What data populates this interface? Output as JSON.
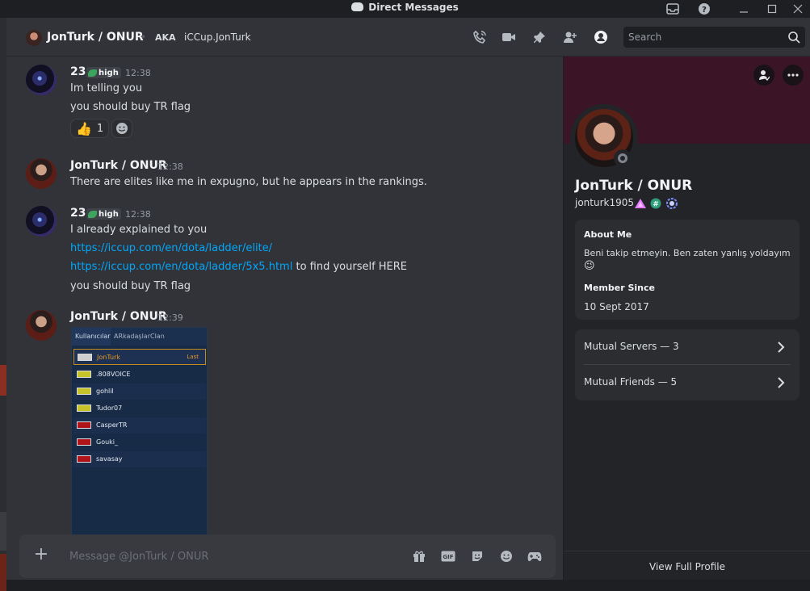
{
  "window": {
    "title": "Direct Messages"
  },
  "header": {
    "dm_name": "JonTurk / ONUR",
    "aka_label": "AKA",
    "aka_value": "iCCup.JonTurk",
    "search_placeholder": "Search"
  },
  "messages": [
    {
      "author": "23",
      "badge": "high",
      "time": "12:38",
      "lines": [
        "Im telling you",
        "you should buy TR flag"
      ],
      "reaction": {
        "emoji": "👍",
        "count": "1"
      }
    },
    {
      "author": "JonTurk / ONUR",
      "time": "12:38",
      "lines": [
        "There are elites like me in expugno, but he appears in the rankings."
      ]
    },
    {
      "author": "23",
      "badge": "high",
      "time": "12:38",
      "lines": [
        "I already explained to you",
        "https://iccup.com/en/dota/ladder/elite/",
        "https://iccup.com/en/dota/ladder/5x5.html",
        "to find yourself HERE",
        "you should buy TR flag"
      ]
    },
    {
      "author": "JonTurk / ONUR",
      "time": "12:39"
    }
  ],
  "attachment": {
    "tabs": [
      "Kullanıcılar",
      "ARkadaşlar",
      "Clan"
    ],
    "rows": [
      {
        "name": "JonTurk",
        "tag": "Last"
      },
      {
        "name": ".808VOICE"
      },
      {
        "name": "gohlil"
      },
      {
        "name": "Tudor07"
      },
      {
        "name": "CasperTR"
      },
      {
        "name": "Gouki_"
      },
      {
        "name": "savasay"
      }
    ]
  },
  "composer": {
    "placeholder": "Message @JonTurk / ONUR"
  },
  "profile": {
    "display_name": "JonTurk / ONUR",
    "username": "jonturk1905",
    "about_title": "About Me",
    "about_text": "Beni takip etmeyin. Ben zaten yanlış yoldayım",
    "about_emoji": "😉",
    "member_since_title": "Member Since",
    "member_since": "10 Sept 2017",
    "mutual_servers": "Mutual Servers — 3",
    "mutual_friends": "Mutual Friends — 5",
    "view_full": "View Full Profile"
  },
  "colors": {
    "accent_link": "#00a8fc",
    "banner": "#3b1525",
    "status_offline": "#80848e"
  }
}
